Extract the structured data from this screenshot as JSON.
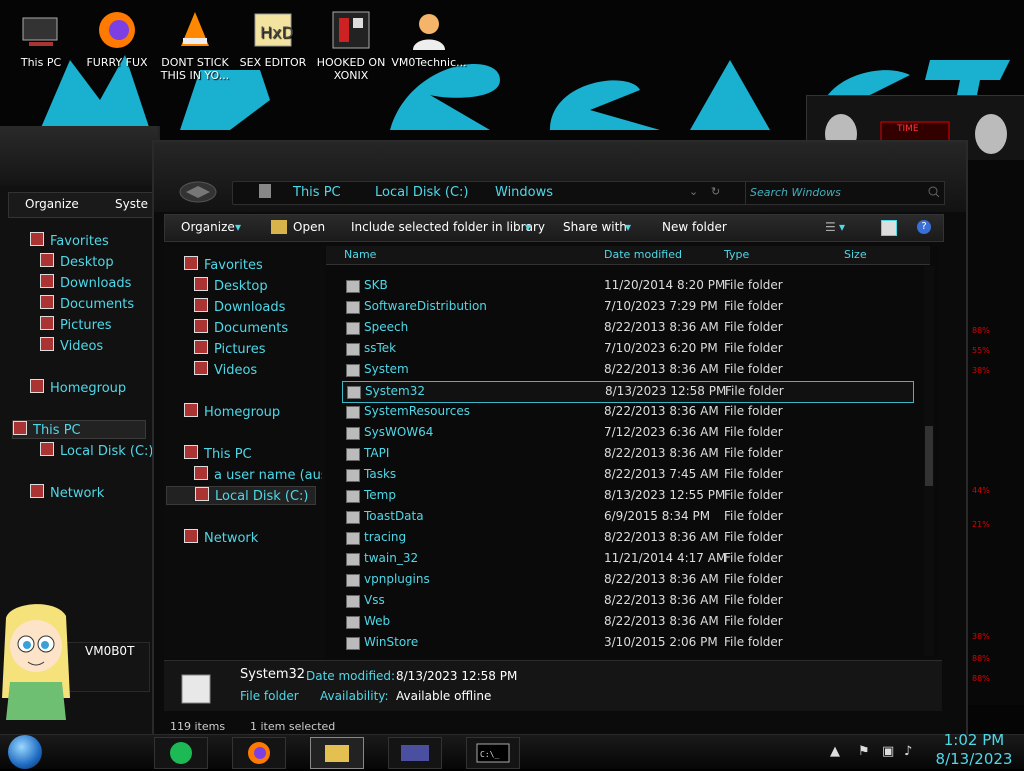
{
  "desktop": {
    "icons": [
      {
        "label": "This PC",
        "icon": "this-pc-icon"
      },
      {
        "label": "FURRY FUX",
        "icon": "firefox-icon"
      },
      {
        "label": "DONT STICK THIS IN YO...",
        "icon": "vlc-icon"
      },
      {
        "label": "SEX EDITOR",
        "icon": "hxd-editor-icon"
      },
      {
        "label": "HOOKED ON XONIX",
        "icon": "xonix-game-icon"
      },
      {
        "label": "VM0Technic...",
        "icon": "user-avatar-icon"
      }
    ]
  },
  "bg_window": {
    "organize": "Organize",
    "system_fragment": "Syste",
    "nav": {
      "favorites": "Favorites",
      "desktop": "Desktop",
      "downloads": "Downloads",
      "documents": "Documents",
      "pictures": "Pictures",
      "videos": "Videos",
      "homegroup": "Homegroup",
      "this_pc": "This PC",
      "local_disk": "Local Disk (C:)",
      "network": "Network"
    },
    "user_label": "VM0B0T"
  },
  "main_window": {
    "breadcrumb": [
      "This PC",
      "Local Disk (C:)",
      "Windows"
    ],
    "search_placeholder": "Search Windows",
    "toolbar": {
      "organize": "Organize",
      "open": "Open",
      "include": "Include selected folder in library",
      "share": "Share with",
      "new_folder": "New folder"
    },
    "nav": {
      "favorites": "Favorites",
      "desktop": "Desktop",
      "downloads": "Downloads",
      "documents": "Documents",
      "pictures": "Pictures",
      "videos": "Videos",
      "homegroup": "Homegroup",
      "this_pc": "This PC",
      "user": "a user name (ause",
      "local_disk": "Local Disk (C:)",
      "network": "Network"
    },
    "columns": {
      "name": "Name",
      "date": "Date modified",
      "type": "Type",
      "size": "Size"
    },
    "rows": [
      {
        "name": "SKB",
        "date": "11/20/2014 8:20 PM",
        "type": "File folder"
      },
      {
        "name": "SoftwareDistribution",
        "date": "7/10/2023 7:29 PM",
        "type": "File folder"
      },
      {
        "name": "Speech",
        "date": "8/22/2013 8:36 AM",
        "type": "File folder"
      },
      {
        "name": "ssTek",
        "date": "7/10/2023 6:20 PM",
        "type": "File folder"
      },
      {
        "name": "System",
        "date": "8/22/2013 8:36 AM",
        "type": "File folder"
      },
      {
        "name": "System32",
        "date": "8/13/2023 12:58 PM",
        "type": "File folder"
      },
      {
        "name": "SystemResources",
        "date": "8/22/2013 8:36 AM",
        "type": "File folder"
      },
      {
        "name": "SysWOW64",
        "date": "7/12/2023 6:36 AM",
        "type": "File folder"
      },
      {
        "name": "TAPI",
        "date": "8/22/2013 8:36 AM",
        "type": "File folder"
      },
      {
        "name": "Tasks",
        "date": "8/22/2013 7:45 AM",
        "type": "File folder"
      },
      {
        "name": "Temp",
        "date": "8/13/2023 12:55 PM",
        "type": "File folder"
      },
      {
        "name": "ToastData",
        "date": "6/9/2015 8:34 PM",
        "type": "File folder"
      },
      {
        "name": "tracing",
        "date": "8/22/2013 8:36 AM",
        "type": "File folder"
      },
      {
        "name": "twain_32",
        "date": "11/21/2014 4:17 AM",
        "type": "File folder"
      },
      {
        "name": "vpnplugins",
        "date": "8/22/2013 8:36 AM",
        "type": "File folder"
      },
      {
        "name": "Vss",
        "date": "8/22/2013 8:36 AM",
        "type": "File folder"
      },
      {
        "name": "Web",
        "date": "8/22/2013 8:36 AM",
        "type": "File folder"
      },
      {
        "name": "WinStore",
        "date": "3/10/2015 2:06 PM",
        "type": "File folder"
      }
    ],
    "selected_row": "System32",
    "details": {
      "name": "System32",
      "type": "File folder",
      "date_label": "Date modified:",
      "date_value": "8/13/2023 12:58 PM",
      "avail_label": "Availability:",
      "avail_value": "Available offline"
    },
    "status": {
      "items": "119 items",
      "selected": "1 item selected"
    }
  },
  "gadget": {
    "title": "TIME",
    "stats": [
      "88%",
      "55%",
      "38%",
      "44%",
      "21%",
      "38%",
      "88%",
      "88%"
    ]
  },
  "taskbar": {
    "time": "1:02 PM",
    "date": "8/13/2023",
    "apps": [
      "spotify-icon",
      "firefox-icon",
      "file-explorer-icon",
      "control-panel-icon",
      "cmd-icon"
    ]
  },
  "colors": {
    "accent": "#4fd8e8",
    "alert": "#d00000"
  }
}
